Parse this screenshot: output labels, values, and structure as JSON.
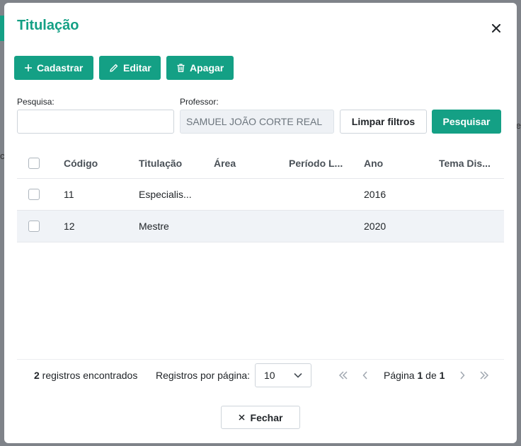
{
  "modal": {
    "title": "Titulação"
  },
  "toolbar": {
    "add_label": "Cadastrar",
    "edit_label": "Editar",
    "delete_label": "Apagar"
  },
  "filters": {
    "search_label": "Pesquisa:",
    "search_value": "",
    "professor_label": "Professor:",
    "professor_value": "SAMUEL JOÃO CORTE REAL",
    "clear_label": "Limpar filtros",
    "search_button": "Pesquisar"
  },
  "table": {
    "columns": [
      "Código",
      "Titulação",
      "Área",
      "Período L...",
      "Ano",
      "Tema Dis..."
    ],
    "rows": [
      {
        "codigo": "11",
        "titulacao": "Especialis...",
        "area": "",
        "periodo": "",
        "ano": "2016",
        "tema": ""
      },
      {
        "codigo": "12",
        "titulacao": "Mestre",
        "area": "",
        "periodo": "",
        "ano": "2020",
        "tema": ""
      }
    ]
  },
  "footer": {
    "count": "2",
    "count_suffix": " registros encontrados",
    "per_page_label": "Registros por página:",
    "per_page_value": "10",
    "page_prefix": "Página ",
    "page_current": "1",
    "page_of": " de ",
    "page_total": "1"
  },
  "close_label": "Fechar",
  "colors": {
    "accent": "#14a085"
  }
}
